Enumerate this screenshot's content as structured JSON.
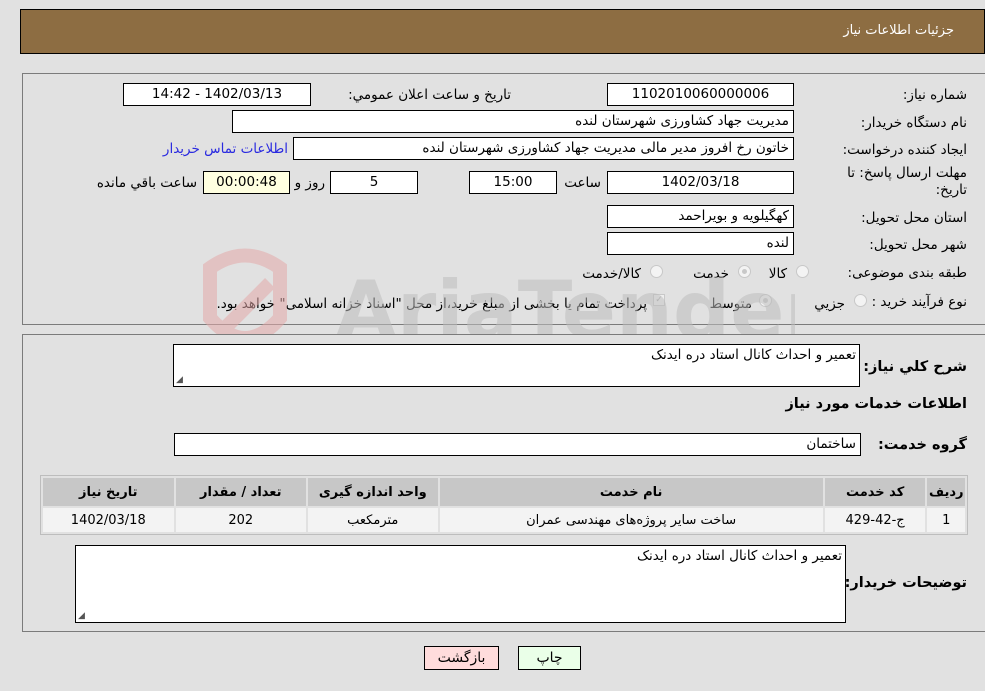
{
  "header": {
    "title": "جزئيات اطلاعات نياز"
  },
  "form": {
    "need_number": {
      "label": "شماره نياز:",
      "value": "1102010060000006"
    },
    "announce_datetime": {
      "label": "تاريخ و ساعت اعلان عمومي:",
      "value": "1402/03/13 - 14:42"
    },
    "buyer_org": {
      "label": "نام دستگاه خريدار:",
      "value": "مديريت جهاد کشاورزی شهرستان لنده"
    },
    "requester": {
      "label": "ايجاد کننده درخواست:",
      "value": "خاتون رخ افروز مدير مالی مديريت جهاد کشاورزی شهرستان لنده"
    },
    "buyer_contact_link": "اطلاعات تماس خريدار",
    "deadline": {
      "label_line1": "مهلت ارسال پاسخ: تا",
      "label_line2": "تاريخ:",
      "date": "1402/03/18",
      "time_label": "ساعت",
      "time": "15:00",
      "days": "5",
      "days_label": "روز و",
      "remaining": "00:00:48",
      "remaining_label": "ساعت باقي مانده"
    },
    "province": {
      "label": "استان محل تحويل:",
      "value": "کهگيلويه و بويراحمد"
    },
    "city": {
      "label": "شهر محل تحويل:",
      "value": "لنده"
    },
    "category": {
      "label": "طبقه بندی موضوعی:",
      "options": [
        "کالا",
        "خدمت",
        "کالا/خدمت"
      ],
      "selected": "خدمت"
    },
    "process_type": {
      "label": "نوع فرآيند خريد :",
      "options": [
        "جزيي",
        "متوسط"
      ],
      "selected": "متوسط",
      "treasury_note": "پرداخت تمام يا بخشی از مبلغ خريد،از محل \"اسناد خزانه اسلامی\" خواهد بود.",
      "treasury_checked": true
    }
  },
  "details": {
    "general_desc": {
      "label": "شرح کلي نياز:",
      "value": "تعمير و احداث کانال استاد دره ايدنک"
    },
    "services_heading": "اطلاعات خدمات مورد نياز",
    "service_group": {
      "label": "گروه خدمت:",
      "value": "ساختمان"
    },
    "table": {
      "columns": [
        "رديف",
        "کد خدمت",
        "نام خدمت",
        "واحد اندازه گيری",
        "تعداد / مقدار",
        "تاريخ نياز"
      ],
      "rows": [
        [
          "1",
          "ج-42-429",
          "ساخت ساير پروژه‌های مهندسی عمران",
          "مترمکعب",
          "202",
          "1402/03/18"
        ]
      ]
    },
    "buyer_notes": {
      "label": "توضيحات خريدار:",
      "value": "تعمير و احداث کانال استاد دره ايدنک"
    }
  },
  "buttons": {
    "print": "چاپ",
    "back": "بازگشت"
  },
  "watermark": {
    "text": "AriaTender.neT"
  }
}
